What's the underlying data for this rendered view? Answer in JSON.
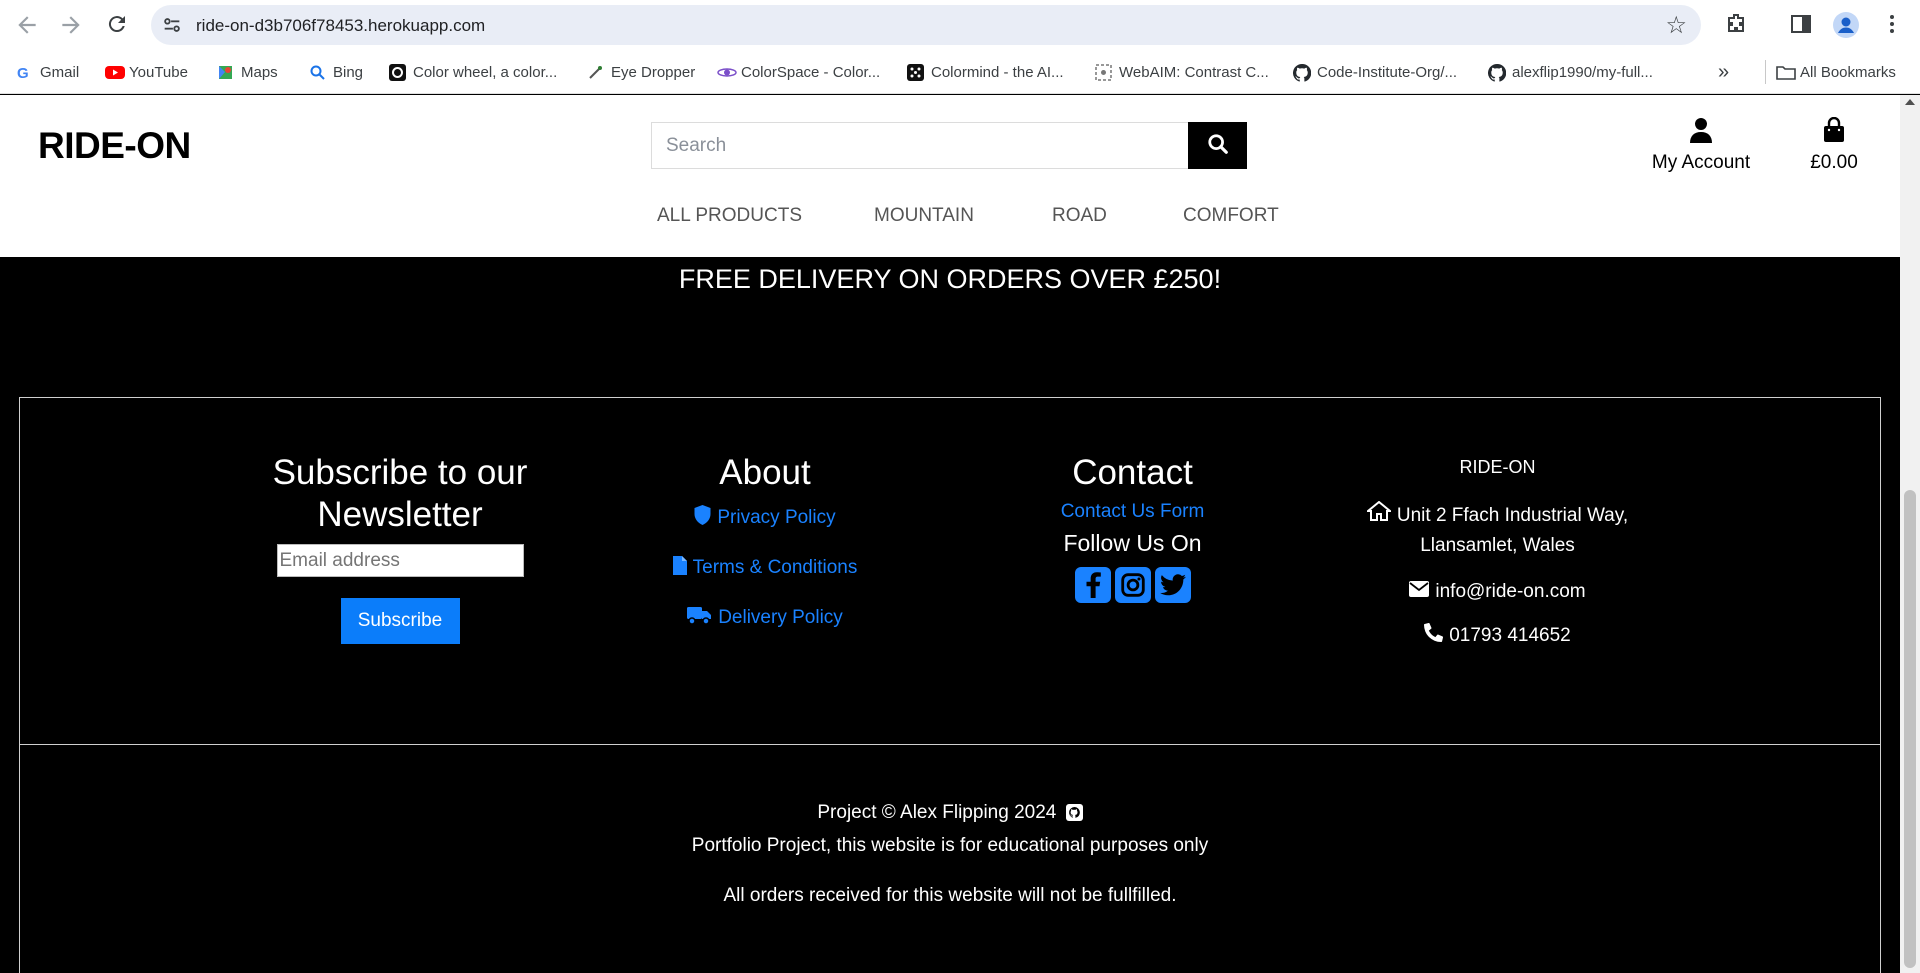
{
  "browser": {
    "url": "ride-on-d3b706f78453.herokuapp.com",
    "bookmarks": [
      {
        "label": "Gmail",
        "icon": "gmail-icon"
      },
      {
        "label": "YouTube",
        "icon": "youtube-icon"
      },
      {
        "label": "Maps",
        "icon": "maps-icon"
      },
      {
        "label": "Bing",
        "icon": "bing-icon"
      },
      {
        "label": "Color wheel, a color...",
        "icon": "color-wheel-icon"
      },
      {
        "label": "Eye Dropper",
        "icon": "eye-dropper-icon"
      },
      {
        "label": "ColorSpace - Color...",
        "icon": "colorspace-icon"
      },
      {
        "label": "Colormind - the AI...",
        "icon": "colormind-icon"
      },
      {
        "label": "WebAIM: Contrast C...",
        "icon": "webaim-icon"
      },
      {
        "label": "Code-Institute-Org/...",
        "icon": "github-icon"
      },
      {
        "label": "alexflip1990/my-full...",
        "icon": "github-icon"
      }
    ],
    "all_bookmarks": "All Bookmarks"
  },
  "header": {
    "logo": "RIDE-ON",
    "search_placeholder": "Search",
    "account_label": "My Account",
    "basket_total": "£0.00"
  },
  "nav": {
    "items": [
      "ALL PRODUCTS",
      "MOUNTAIN",
      "ROAD",
      "COMFORT"
    ]
  },
  "banner": {
    "text": "FREE DELIVERY ON ORDERS OVER £250!"
  },
  "footer": {
    "newsletter": {
      "title": "Subscribe to our Newsletter",
      "email_placeholder": "Email address",
      "button": "Subscribe"
    },
    "about": {
      "title": "About",
      "links": [
        "Privacy Policy",
        "Terms & Conditions",
        "Delivery Policy"
      ]
    },
    "contact": {
      "title": "Contact",
      "form_link": "Contact Us Form",
      "follow": "Follow Us On"
    },
    "address": {
      "brand": "RIDE-ON",
      "line1": "Unit 2 Ffach Industrial Way,",
      "line2": "Llansamlet, Wales",
      "email": "info@ride-on.com",
      "phone": "01793 414652"
    },
    "copyright": "Project © Alex Flipping 2024",
    "disclaimer": "Portfolio Project, this website is for educational purposes only",
    "notice": "All orders received for this website will not be fullfilled."
  },
  "colors": {
    "link_blue": "#1a82ff",
    "button_blue": "#0b7dfa",
    "footer_bg": "#000000"
  }
}
